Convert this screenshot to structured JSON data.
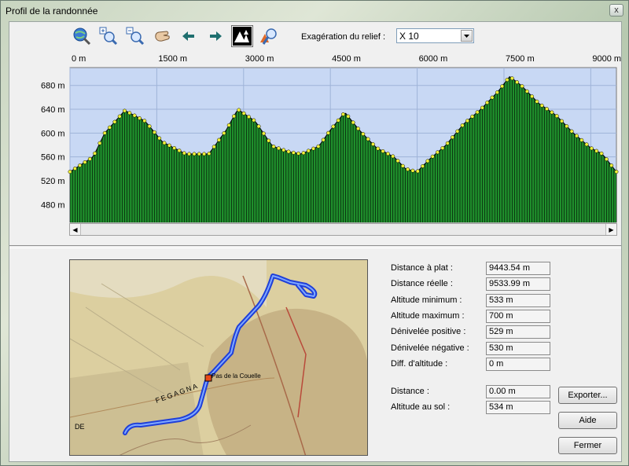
{
  "window": {
    "title": "Profil de la randonnée",
    "close_label": "x"
  },
  "toolbar": {
    "buttons": [
      {
        "name": "zoom-all",
        "icon": "globe-magnifier-icon"
      },
      {
        "name": "zoom-in",
        "icon": "zoom-in-icon"
      },
      {
        "name": "zoom-out",
        "icon": "zoom-out-icon"
      },
      {
        "name": "pan",
        "icon": "hand-icon"
      },
      {
        "name": "previous",
        "icon": "arrow-left-icon"
      },
      {
        "name": "next",
        "icon": "arrow-right-icon"
      },
      {
        "name": "relief",
        "icon": "mountain-trees-icon",
        "active": true
      },
      {
        "name": "terrain-zoom",
        "icon": "terrain-magnifier-icon"
      }
    ],
    "relief_label": "Exagération du relief :",
    "relief_value": "X 10"
  },
  "chart_data": {
    "type": "area",
    "x_ticks": [
      "0 m",
      "1500 m",
      "3000 m",
      "4500 m",
      "6000 m",
      "7500 m",
      "9000 m"
    ],
    "x_tick_values": [
      0,
      1500,
      3000,
      4500,
      6000,
      7500,
      9000
    ],
    "y_ticks": [
      "480 m",
      "520 m",
      "560 m",
      "600 m",
      "640 m",
      "680 m"
    ],
    "y_tick_values": [
      480,
      520,
      560,
      600,
      640,
      680
    ],
    "xlim": [
      0,
      9443.54
    ],
    "ylim": [
      450,
      710
    ],
    "grid": true,
    "colors": {
      "plot_bg": "#c8d8f4",
      "fill": "#1f8f2c",
      "stroke": "#000000",
      "marker": "#f2f23a"
    },
    "x": [
      0,
      400,
      600,
      950,
      1300,
      1600,
      2000,
      2400,
      2700,
      2900,
      3200,
      3500,
      3800,
      4000,
      4300,
      4500,
      4750,
      5000,
      5300,
      5600,
      5800,
      6000,
      6200,
      6500,
      6800,
      7100,
      7400,
      7600,
      7800,
      8100,
      8400,
      8700,
      9000,
      9200,
      9443
    ],
    "y": [
      535,
      560,
      600,
      638,
      620,
      585,
      565,
      565,
      605,
      640,
      620,
      578,
      568,
      565,
      578,
      605,
      635,
      605,
      575,
      560,
      540,
      535,
      555,
      580,
      615,
      640,
      670,
      695,
      680,
      650,
      630,
      600,
      575,
      565,
      535
    ]
  },
  "stats": [
    {
      "label": "Distance à plat :",
      "value": "9443.54 m"
    },
    {
      "label": "Distance réelle :",
      "value": "9533.99 m"
    },
    {
      "label": "Altitude minimum :",
      "value": "533 m"
    },
    {
      "label": "Altitude maximum :",
      "value": "700 m"
    },
    {
      "label": "Dénivelée positive :",
      "value": "529 m"
    },
    {
      "label": "Dénivelée négative :",
      "value": "530 m"
    },
    {
      "label": "Diff. d'altitude :",
      "value": "0 m"
    }
  ],
  "cursor": [
    {
      "label": "Distance :",
      "value": "0.00 m"
    },
    {
      "label": "Altitude au sol :",
      "value": "534 m"
    }
  ],
  "buttons": {
    "export": "Exporter...",
    "help": "Aide",
    "close": "Fermer"
  },
  "map": {
    "label_pass": "Pas de la Couelle",
    "label_area": "FEGAGNA",
    "label_de": "DE"
  }
}
